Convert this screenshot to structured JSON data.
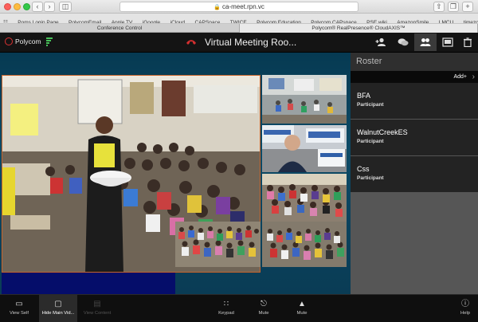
{
  "browser": {
    "url": "ca-meet.rpn.vc",
    "favorites": [
      "Poms Login Page",
      "PolycomEmail",
      "Apple TV",
      "iGoogle",
      "iCloud",
      "CAPSpace",
      "TWICE",
      "Polycom Education",
      "Polycom CAPspace",
      "PSE wiki",
      "AmazonSmile",
      "LMCU",
      "timezone buddy"
    ],
    "tabs": [
      "Conference Control",
      "Polycom® RealPresence® CloudAXIS™"
    ]
  },
  "app": {
    "logo_text": "Polycom",
    "meeting_title": "Virtual Meeting Roo...",
    "header_icons": [
      "add-participant-icon",
      "chat-icon",
      "roster-icon",
      "layout-icon",
      "trash-icon"
    ]
  },
  "roster": {
    "title": "Roster",
    "add_label": "Add+",
    "participants": [
      {
        "name": "BFA",
        "role": "Participant"
      },
      {
        "name": "WalnutCreekES",
        "role": "Participant"
      },
      {
        "name": "Css",
        "role": "Participant"
      }
    ]
  },
  "toolbar": {
    "view_self": "View Self",
    "hide_main_video": "Hide Main Vid...",
    "view_content": "View Content",
    "keypad": "Keypad",
    "mute_mic": "Mute",
    "mute_speaker": "Mute",
    "help": "Help"
  },
  "colors": {
    "accent_orange": "#c7632a",
    "stage_blue": "#0a3c55",
    "signal_green": "#48c25a",
    "hangup_red": "#d32f2f"
  }
}
